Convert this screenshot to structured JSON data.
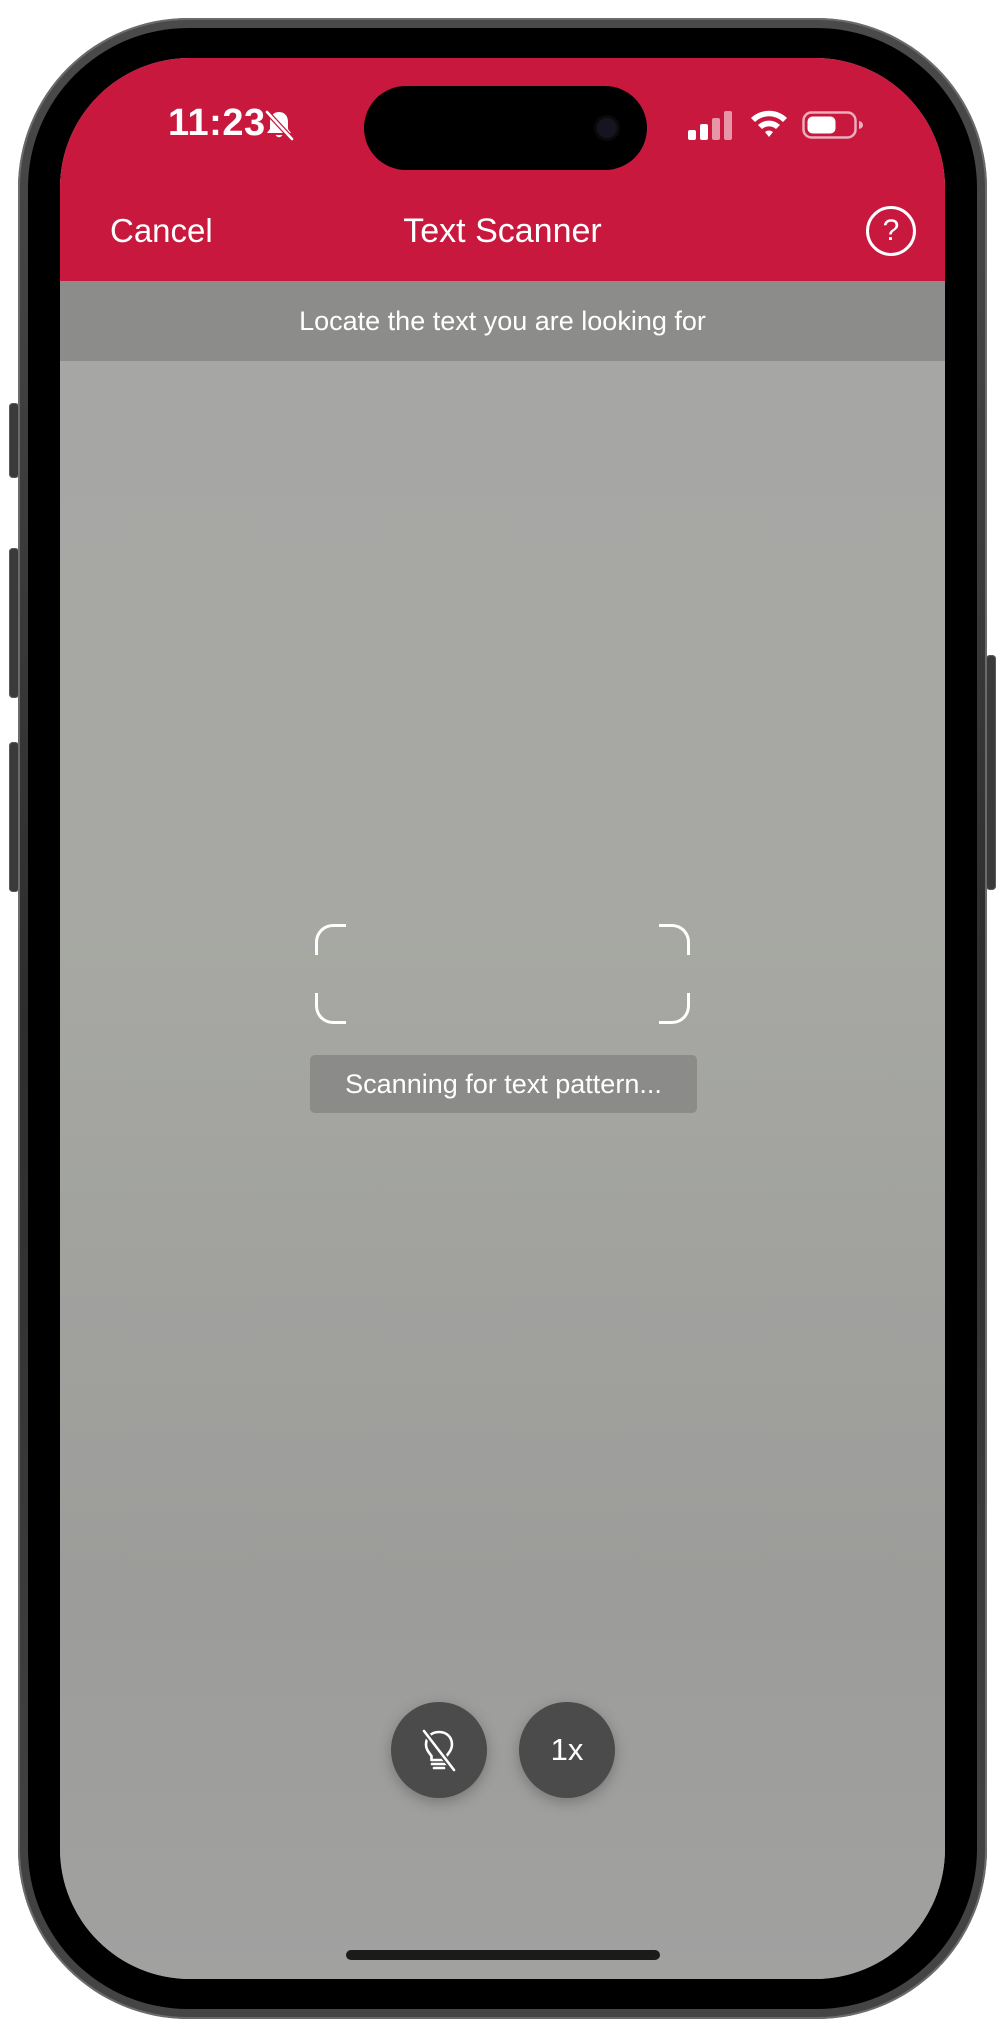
{
  "status_bar": {
    "time": "11:23",
    "icons": [
      "bell-slash-icon",
      "cellular-signal-icon",
      "wifi-icon",
      "battery-icon"
    ]
  },
  "nav": {
    "cancel_label": "Cancel",
    "title": "Text Scanner",
    "help_label": "?",
    "help_icon": "question-circle-icon"
  },
  "instruction": {
    "text": "Locate the text you are looking for"
  },
  "scanner": {
    "status_text": "Scanning for text pattern..."
  },
  "controls": {
    "flash_icon": "flashlight-off-icon",
    "zoom_label": "1x"
  },
  "colors": {
    "header_red": "#c8183d",
    "instruction_bar": "#8c8c8a",
    "camera_gray": "#a5a5a3",
    "control_button": "#4b4b4b",
    "text_white": "#ffffff"
  }
}
